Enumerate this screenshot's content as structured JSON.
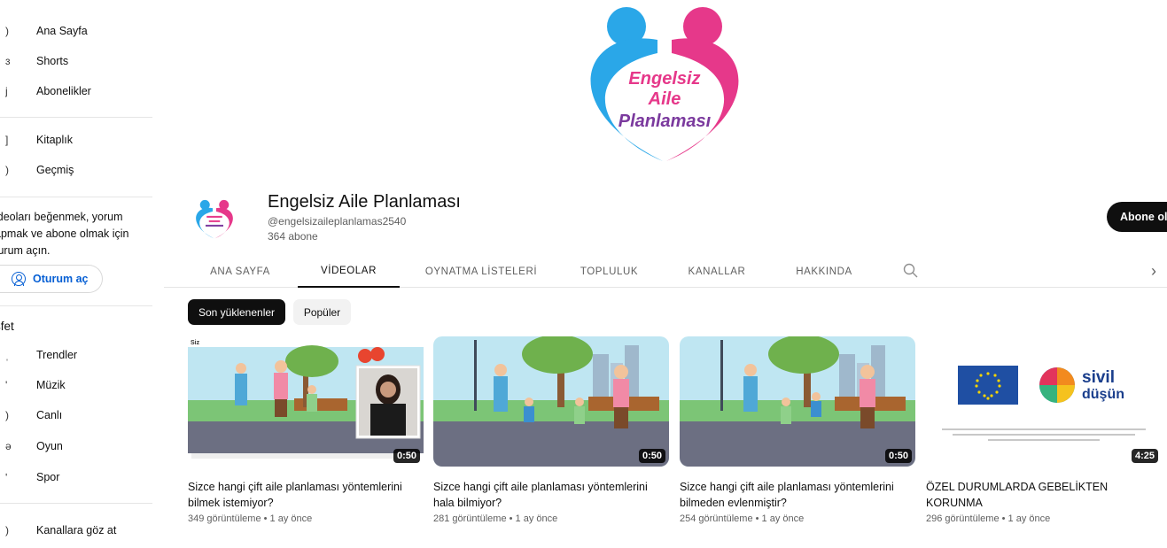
{
  "sidebar": {
    "items_top": [
      {
        "label": "Ana Sayfa",
        "glyph": ")"
      },
      {
        "label": "Shorts",
        "glyph": "ɜ"
      },
      {
        "label": "Abonelikler",
        "glyph": "j"
      }
    ],
    "items_mid": [
      {
        "label": "Kitaplık",
        "glyph": "]"
      },
      {
        "label": "Geçmiş",
        "glyph": ")"
      }
    ],
    "signin_lines": [
      "ideoları beğenmek, yorum",
      "apmak ve abone olmak için",
      "turum açın."
    ],
    "signin_button": "Oturum aç",
    "section_title": "şfet",
    "explore_items": [
      {
        "label": "Trendler",
        "glyph": "ˌ"
      },
      {
        "label": "Müzik",
        "glyph": "'"
      },
      {
        "label": "Canlı",
        "glyph": ")"
      },
      {
        "label": "Oyun",
        "glyph": "ə"
      },
      {
        "label": "Spor",
        "glyph": "ʹ"
      }
    ],
    "browse_channels": {
      "label": "Kanallara göz at",
      "glyph": ")"
    }
  },
  "banner": {
    "logo_words": [
      "Engelsiz",
      "Aile",
      "Planlaması"
    ],
    "colors": {
      "blue": "#2aa7e8",
      "pink": "#e6388a",
      "text": "#7b3a9e"
    }
  },
  "channel": {
    "name": "Engelsiz Aile Planlaması",
    "handle": "@engelsizaileplanlamas2540",
    "subscribers": "364 abone",
    "subscribe_label": "Abone ol"
  },
  "tabs": [
    {
      "label": "ANA SAYFA",
      "active": false
    },
    {
      "label": "VİDEOLAR",
      "active": true
    },
    {
      "label": "OYNATMA LİSTELERİ",
      "active": false
    },
    {
      "label": "TOPLULUK",
      "active": false
    },
    {
      "label": "KANALLAR",
      "active": false
    },
    {
      "label": "HAKKINDA",
      "active": false
    }
  ],
  "chips": [
    {
      "label": "Son yüklenenler",
      "active": true
    },
    {
      "label": "Popüler",
      "active": false
    }
  ],
  "videos": [
    {
      "title_lines": [
        "Sizce hangi çift aile planlaması yöntemlerini",
        "bilmek istemiyor?"
      ],
      "meta": "349 görüntüleme • 1 ay önce",
      "duration": "0:50",
      "thumb": "cartoon-with-signer",
      "thumb_label": "Siz"
    },
    {
      "title_lines": [
        "Sizce hangi çift aile planlaması yöntemlerini",
        "hala bilmiyor?"
      ],
      "meta": "281 görüntüleme • 1 ay önce",
      "duration": "0:50",
      "thumb": "cartoon"
    },
    {
      "title_lines": [
        "Sizce hangi çift aile planlaması yöntemlerini",
        "bilmeden evlenmiştir?"
      ],
      "meta": "254 görüntüleme • 1 ay önce",
      "duration": "0:50",
      "thumb": "cartoon"
    },
    {
      "title_lines": [
        "ÖZEL DURUMLARDA GEBELİKTEN",
        "KORUNMA"
      ],
      "meta": "296 görüntüleme • 1 ay önce",
      "duration": "4:25",
      "thumb": "eu-sivil-dusun",
      "thumb_brand": "sivil",
      "thumb_brand2": "düşün"
    }
  ]
}
